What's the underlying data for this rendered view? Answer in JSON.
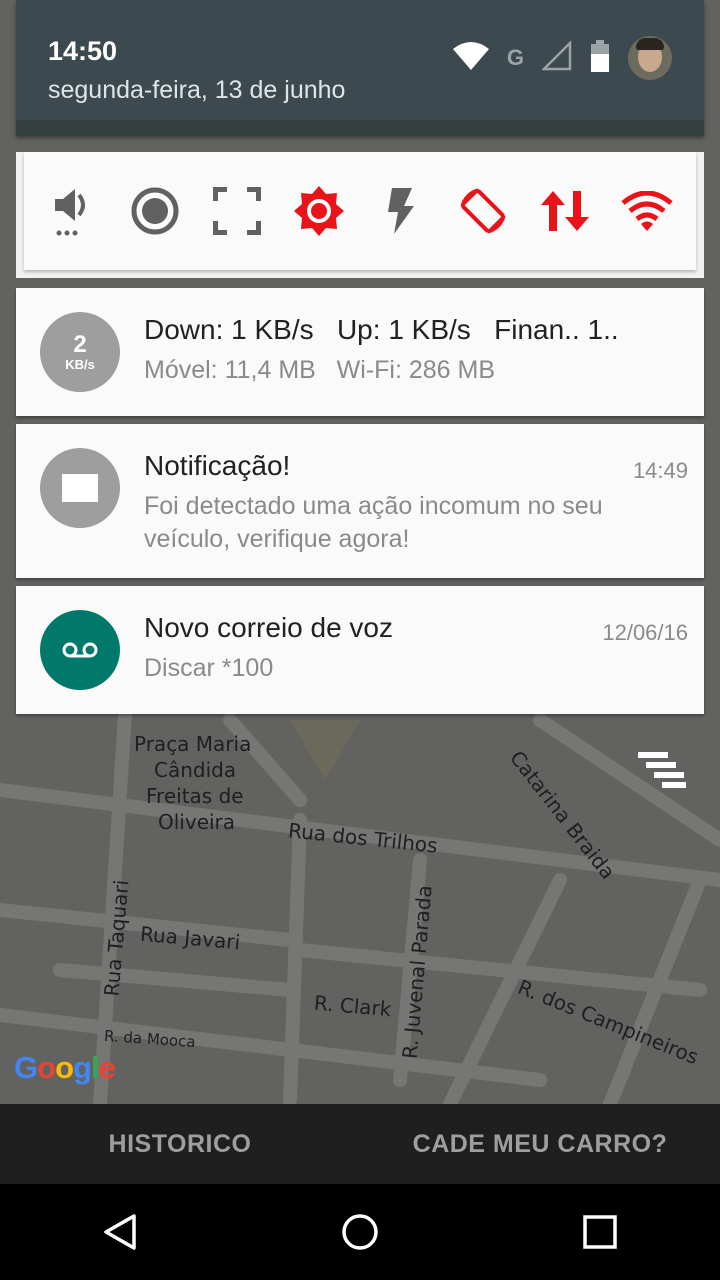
{
  "status": {
    "time": "14:50",
    "date": "segunda-feira, 13 de junho",
    "network_label": "G"
  },
  "quick_settings": [
    {
      "icon": "volume-icon"
    },
    {
      "icon": "record-icon"
    },
    {
      "icon": "fullscreen-icon"
    },
    {
      "icon": "brightness-icon"
    },
    {
      "icon": "flash-icon"
    },
    {
      "icon": "rotate-icon"
    },
    {
      "icon": "data-transfer-icon"
    },
    {
      "icon": "wifi-icon"
    }
  ],
  "notifications": {
    "speed": {
      "icon_value": "2",
      "icon_unit": "KB/s",
      "title": "Down: 1 KB/s   Up: 1 KB/s   Finan.. 1..",
      "text": "Móvel: 11,4 MB   Wi-Fi: 286 MB"
    },
    "alert": {
      "title": "Notificação!",
      "time": "14:49",
      "line1": "Foi detectado uma ação incomum no seu",
      "line2": "veículo, verifique agora!"
    },
    "voicemail": {
      "title": "Novo correio de voz",
      "time": "12/06/16",
      "text": "Discar *100"
    }
  },
  "map": {
    "labels": {
      "praca1": "Praça Maria",
      "praca2": "Cândida",
      "praca3": "Freitas de",
      "praca4": "Oliveira",
      "trilhos": "Rua dos Trilhos",
      "taquari": "Rua Taquari",
      "javari": "Rua Javari",
      "juvenal": "R. Juvenal Parada",
      "clark": "R. Clark",
      "campineiros": "R. dos Campineiros",
      "mooca": "R. da Mooca",
      "catarina": "Catarina Braida"
    },
    "google_logo": "Google"
  },
  "appbar": {
    "historico": "HISTORICO",
    "cade": "CADE MEU CARRO?"
  },
  "colors": {
    "accent_red": "#e8141a",
    "voicemail_teal": "#00796b",
    "header_bg": "#3c4a4f"
  }
}
